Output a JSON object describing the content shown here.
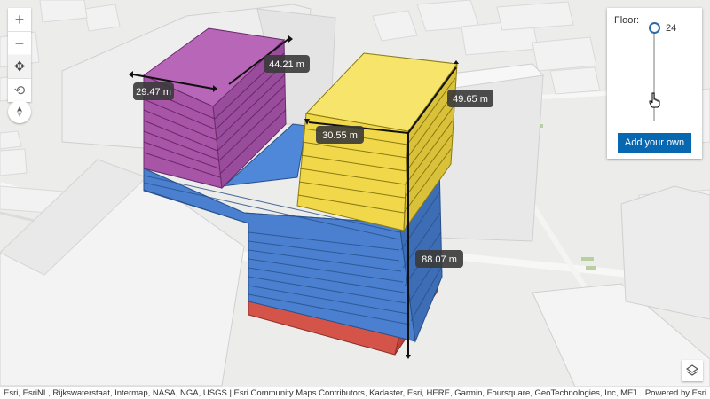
{
  "map": {
    "measurements": [
      "29.47 m",
      "44.21 m",
      "30.55 m",
      "49.65 m",
      "88.07 m"
    ],
    "volume_colors": {
      "purple": "#a855a8",
      "yellow": "#f0d84a",
      "blue": "#4a80cf",
      "red": "#d4544a"
    }
  },
  "nav_controls": {
    "zoom_in": "+",
    "zoom_out": "−",
    "pan": "✥",
    "rotate": "⟲"
  },
  "floor_panel": {
    "label": "Floor:",
    "value": "24",
    "add_button": "Add your own"
  },
  "attribution": {
    "text": "Esri, EsriNL, Rijkswaterstaat, Intermap, NASA, NGA, USGS | Esri Community Maps Contributors, Kadaster, Esri, HERE, Garmin, Foursquare, GeoTechnologies, Inc, METI/NASA, USGS | Source: ...",
    "powered_by": "Powered by Esri"
  },
  "icons": [
    "zoom-in-icon",
    "zoom-out-icon",
    "pan-icon",
    "rotate-icon",
    "compass-icon",
    "layers-icon",
    "hand-cursor-icon"
  ]
}
